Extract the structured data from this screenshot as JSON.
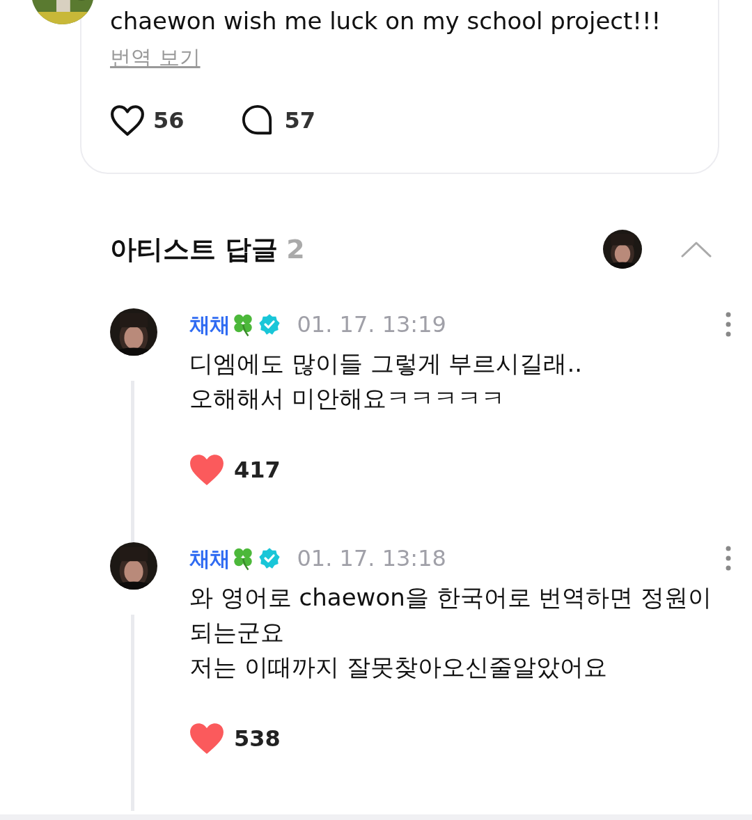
{
  "post": {
    "text": "chaewon wish me luck on my school project!!!",
    "translate_link": "번역 보기",
    "likes": {
      "count": "56",
      "liked": false
    },
    "comments_count": "57"
  },
  "artist_replies": {
    "title": "아티스트 답글",
    "count": "2",
    "expanded": true,
    "replies": [
      {
        "author": "채채",
        "time": "01. 17. 13:19",
        "text": "디엠에도 많이들 그렇게 부르시길래..\n오해해서 미안해요ㅋㅋㅋㅋㅋ",
        "likes": "417",
        "liked": true
      },
      {
        "author": "채채",
        "time": "01. 17. 13:18",
        "text": "와 영어로 chaewon을 한국어로 번역하면 정원이 되는군요\n저는 이때까지 잘못찾아오신줄알았어요",
        "likes": "538",
        "liked": true
      }
    ]
  }
}
